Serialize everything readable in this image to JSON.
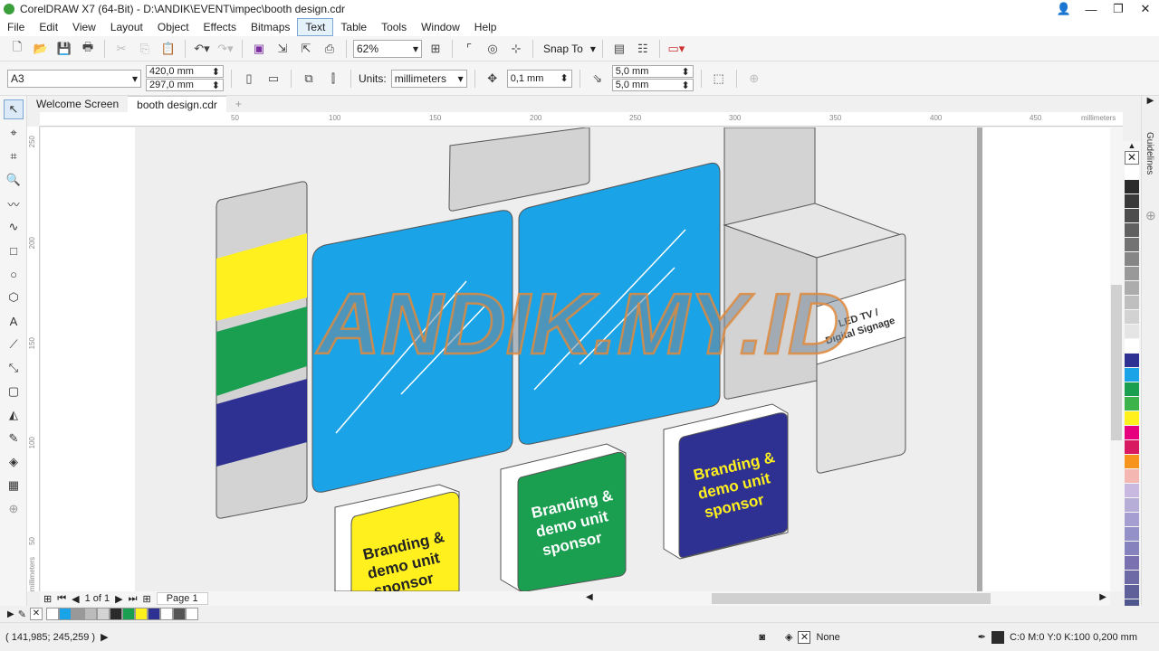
{
  "window": {
    "title": "CorelDRAW X7 (64-Bit) - D:\\ANDIK\\EVENT\\impec\\booth design.cdr"
  },
  "menu": [
    "File",
    "Edit",
    "View",
    "Layout",
    "Object",
    "Effects",
    "Bitmaps",
    "Text",
    "Table",
    "Tools",
    "Window",
    "Help"
  ],
  "menu_active": "Text",
  "toolbar": {
    "zoom": "62%",
    "snap_label": "Snap To"
  },
  "property_bar": {
    "page_size": "A3",
    "width": "420,0 mm",
    "height": "297,0 mm",
    "units_label": "Units:",
    "units_value": "millimeters",
    "nudge": "0,1 mm",
    "dup_x": "5,0 mm",
    "dup_y": "5,0 mm"
  },
  "tabs": [
    {
      "label": "Welcome Screen"
    },
    {
      "label": "booth design.cdr"
    }
  ],
  "ruler": {
    "h_ticks": [
      "50",
      "100",
      "150",
      "200",
      "250",
      "300",
      "350",
      "400",
      "450"
    ],
    "h_unit": "millimeters",
    "v_ticks": [
      "250",
      "200",
      "150",
      "100",
      "50"
    ],
    "v_unit": "millimeters"
  },
  "drawing": {
    "watermark": "ANDIK.MY.ID",
    "led_line1": "LED TV /",
    "led_line2": "Digital Signage",
    "branding_line1": "Branding &",
    "branding_line2": "demo unit",
    "branding_line3": "sponsor",
    "colors": {
      "blue": "#1aa3e6",
      "yellow": "#fff01e",
      "green": "#1a9e4f",
      "navy": "#2e3192",
      "gray": "#d3d3d3"
    }
  },
  "docker": {
    "label": "Guidelines"
  },
  "page_nav": {
    "counter": "1 of 1",
    "page_tab": "Page 1"
  },
  "status": {
    "coords": "( 141,985; 245,259 )",
    "fill_label": "None",
    "outline_label": "C:0 M:0 Y:0 K:100  0,200 mm"
  },
  "palette_colors": [
    "#ffffff",
    "#2b2b2b",
    "#3a3a3a",
    "#4d4d4d",
    "#606060",
    "#737373",
    "#868686",
    "#999999",
    "#acacac",
    "#bfbfbf",
    "#d2d2d2",
    "#e5e5e5",
    "#ffffff",
    "#2e3192",
    "#1aa3e6",
    "#1a9e4f",
    "#3cb44b",
    "#fff01e",
    "#e6007e",
    "#d81b60",
    "#f7941d",
    "#f5b7b1",
    "#c9b8e0",
    "#b7aed8",
    "#a59ed1",
    "#9491c8",
    "#8582bd",
    "#7a72b0",
    "#6d6aa6",
    "#5f5f9a",
    "#50578d"
  ],
  "doc_palette": [
    "#ffffff",
    "#1aa3e6",
    "#999999",
    "#bbbbbb",
    "#d3d3d3",
    "#2b2b2b",
    "#1a9e4f",
    "#fff01e",
    "#2e3192",
    "#ffffff",
    "#555555",
    "#ffffff"
  ]
}
